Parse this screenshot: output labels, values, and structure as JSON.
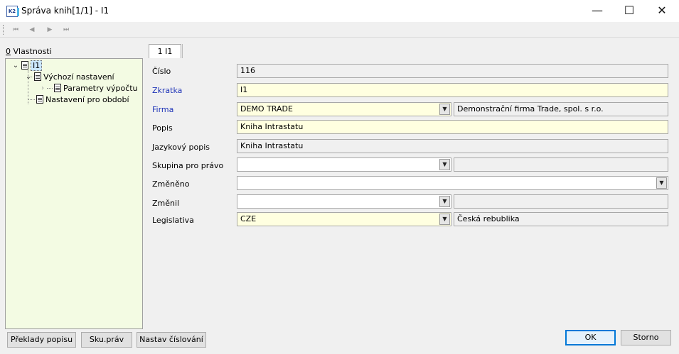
{
  "window": {
    "title": "Správa knih[1/1] - I1",
    "app_icon_text": "K2",
    "minimize": "—",
    "maximize": "☐",
    "close": "✕"
  },
  "toolbar": {
    "first": "⏮",
    "prev": "◀",
    "next": "▶",
    "last": "⏭"
  },
  "tree": {
    "header_accel": "0",
    "header_rest": " Vlastnosti",
    "root": "I1",
    "items": [
      "Výchozí nastavení",
      "Parametry výpočtu",
      "Nastavení pro období"
    ]
  },
  "tab": {
    "label": "1 I1"
  },
  "form": {
    "cislo": {
      "label": "Číslo",
      "value": "116"
    },
    "zkratka": {
      "label": "Zkratka",
      "value": "I1"
    },
    "firma": {
      "label": "Firma",
      "value": "DEMO TRADE",
      "description": "Demonstrační firma Trade, spol. s r.o."
    },
    "popis": {
      "label": "Popis",
      "value": "Kniha Intrastatu"
    },
    "jazykovy_popis": {
      "label": "Jazykový popis",
      "value": "Kniha Intrastatu"
    },
    "skupina": {
      "label": "Skupina pro právo",
      "value": "",
      "description": ""
    },
    "zmeneno": {
      "label": "Změněno",
      "value": " .  .      : :"
    },
    "zmenil": {
      "label": "Změnil",
      "value": "",
      "description": ""
    },
    "legislativa": {
      "label": "Legislativa",
      "value": "CZE",
      "description": "Česká rebublika"
    }
  },
  "buttons": {
    "preklady": "Překlady popisu",
    "sku_prav": "Sku.práv",
    "nastav_cislovani": "Nastav číslování",
    "ok": "OK",
    "storno": "Storno"
  },
  "colors": {
    "tree_bg": "#f3fbe3",
    "required_label": "#1f34b8",
    "editable_field": "#ffffe0"
  }
}
